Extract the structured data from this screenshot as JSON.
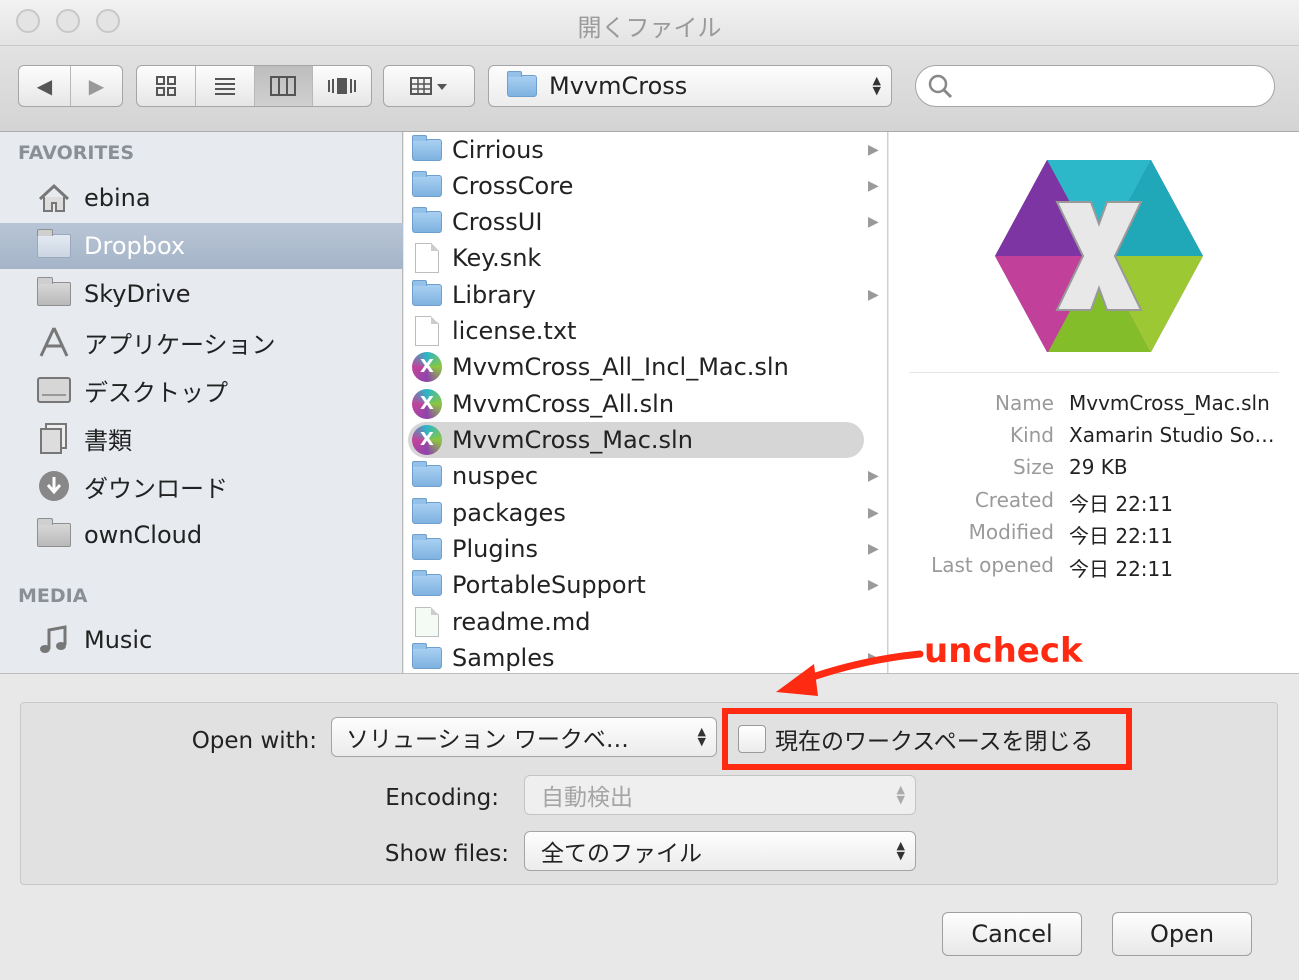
{
  "window": {
    "title": "開くファイル"
  },
  "toolbar": {
    "nav_back": "◀",
    "nav_forward": "▶",
    "location": "MvvmCross",
    "search_placeholder": ""
  },
  "sidebar": {
    "favorites_header": "FAVORITES",
    "media_header": "MEDIA",
    "items": [
      {
        "label": "ebina",
        "icon": "home-icon"
      },
      {
        "label": "Dropbox",
        "icon": "folder-icon"
      },
      {
        "label": "SkyDrive",
        "icon": "folder-icon"
      },
      {
        "label": "アプリケーション",
        "icon": "applications-icon"
      },
      {
        "label": "デスクトップ",
        "icon": "desktop-icon"
      },
      {
        "label": "書類",
        "icon": "documents-icon"
      },
      {
        "label": "ダウンロード",
        "icon": "downloads-icon"
      },
      {
        "label": "ownCloud",
        "icon": "folder-icon"
      }
    ],
    "media_items": [
      {
        "label": "Music",
        "icon": "music-icon"
      }
    ]
  },
  "files": [
    {
      "name": "Cirrious",
      "type": "folder"
    },
    {
      "name": "CrossCore",
      "type": "folder"
    },
    {
      "name": "CrossUI",
      "type": "folder"
    },
    {
      "name": "Key.snk",
      "type": "file"
    },
    {
      "name": "Library",
      "type": "folder"
    },
    {
      "name": "license.txt",
      "type": "file"
    },
    {
      "name": "MvvmCross_All_Incl_Mac.sln",
      "type": "solution"
    },
    {
      "name": "MvvmCross_All.sln",
      "type": "solution"
    },
    {
      "name": "MvvmCross_Mac.sln",
      "type": "solution"
    },
    {
      "name": "nuspec",
      "type": "folder"
    },
    {
      "name": "packages",
      "type": "folder"
    },
    {
      "name": "Plugins",
      "type": "folder"
    },
    {
      "name": "PortableSupport",
      "type": "folder"
    },
    {
      "name": "readme.md",
      "type": "file"
    },
    {
      "name": "Samples",
      "type": "folder"
    }
  ],
  "preview": {
    "name_label": "Name",
    "name": "MvvmCross_Mac.sln",
    "kind_label": "Kind",
    "kind": "Xamarin Studio So…",
    "size_label": "Size",
    "size": "29 KB",
    "created_label": "Created",
    "created": "今日 22:11",
    "modified_label": "Modified",
    "modified": "今日 22:11",
    "opened_label": "Last opened",
    "opened": "今日 22:11"
  },
  "options": {
    "open_with_label": "Open with:",
    "open_with_value": "ソリューション ワークベ…",
    "close_workspace_label": "現在のワークスペースを閉じる",
    "close_workspace_checked": false,
    "encoding_label": "Encoding:",
    "encoding_value": "自動検出",
    "show_files_label": "Show files:",
    "show_files_value": "全てのファイル"
  },
  "buttons": {
    "cancel": "Cancel",
    "open": "Open"
  },
  "annotation": {
    "text": "uncheck",
    "color": "#ff2a12"
  }
}
